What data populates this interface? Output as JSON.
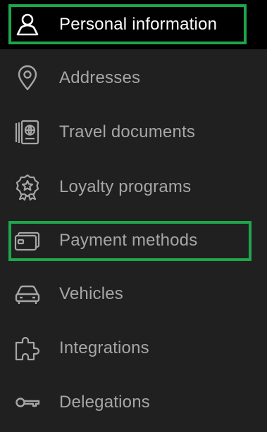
{
  "colors": {
    "background": "#202020",
    "active_background": "#000000",
    "text": "#a6a6a6",
    "active_text": "#ffffff",
    "highlight_border": "#1ea64b"
  },
  "menu": {
    "items": [
      {
        "label": "Personal information",
        "icon": "person-icon",
        "active": true,
        "highlighted": true
      },
      {
        "label": "Addresses",
        "icon": "location-pin-icon",
        "active": false,
        "highlighted": false
      },
      {
        "label": "Travel documents",
        "icon": "passport-icon",
        "active": false,
        "highlighted": false
      },
      {
        "label": "Loyalty programs",
        "icon": "award-badge-icon",
        "active": false,
        "highlighted": false
      },
      {
        "label": "Payment methods",
        "icon": "credit-card-icon",
        "active": false,
        "highlighted": true
      },
      {
        "label": "Vehicles",
        "icon": "car-icon",
        "active": false,
        "highlighted": false
      },
      {
        "label": "Integrations",
        "icon": "puzzle-piece-icon",
        "active": false,
        "highlighted": false
      },
      {
        "label": "Delegations",
        "icon": "key-icon",
        "active": false,
        "highlighted": false
      }
    ]
  }
}
